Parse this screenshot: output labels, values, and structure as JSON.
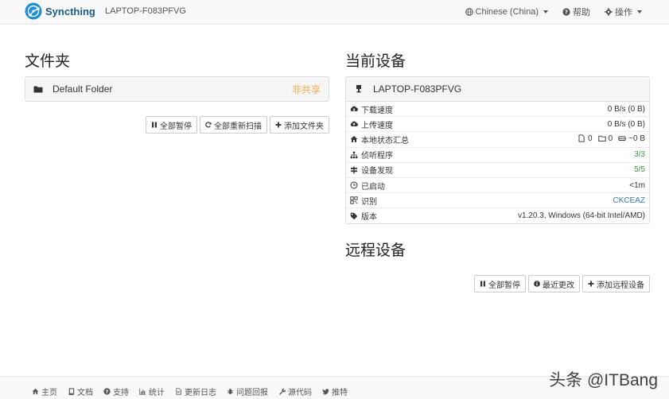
{
  "navbar": {
    "brand": "Syncthing",
    "hostname": "LAPTOP-F083PFVG",
    "language": "Chinese (China)",
    "help": "帮助",
    "actions": "操作"
  },
  "folders": {
    "title": "文件夹",
    "items": [
      {
        "name": "Default Folder",
        "status": "非共享"
      }
    ],
    "buttons": {
      "pause_all": "全部暂停",
      "rescan_all": "全部重新扫描",
      "add_folder": "添加文件夹"
    }
  },
  "this_device": {
    "title": "当前设备",
    "name": "LAPTOP-F083PFVG",
    "rows": {
      "download": {
        "label": "下载速度",
        "value": "0 B/s (0 B)"
      },
      "upload": {
        "label": "上传速度",
        "value": "0 B/s (0 B)"
      },
      "local_state": {
        "label": "本地状态汇总",
        "files": "0",
        "dirs": "0",
        "size": "~0 B"
      },
      "listeners": {
        "label": "侦听程序",
        "value": "3/3"
      },
      "discovery": {
        "label": "设备发现",
        "value": "5/5"
      },
      "uptime": {
        "label": "已启动",
        "value": "<1m"
      },
      "identity": {
        "label": "识别",
        "value": "CKCEAZ"
      },
      "version": {
        "label": "版本",
        "value": "v1.20.3, Windows (64-bit Intel/AMD)"
      }
    }
  },
  "remote_devices": {
    "title": "远程设备",
    "buttons": {
      "pause_all": "全部暂停",
      "recent_changes": "最近更改",
      "add_remote": "添加远程设备"
    }
  },
  "footer": {
    "links": [
      "主页",
      "文档",
      "支持",
      "统计",
      "更新日志",
      "问题回报",
      "源代码",
      "推特"
    ]
  },
  "watermark": "头条 @ITBang",
  "colors": {
    "brand": "#1c5b8e",
    "warning": "#f0ad4e",
    "success": "#3c9d3c",
    "link": "#337ab7"
  }
}
